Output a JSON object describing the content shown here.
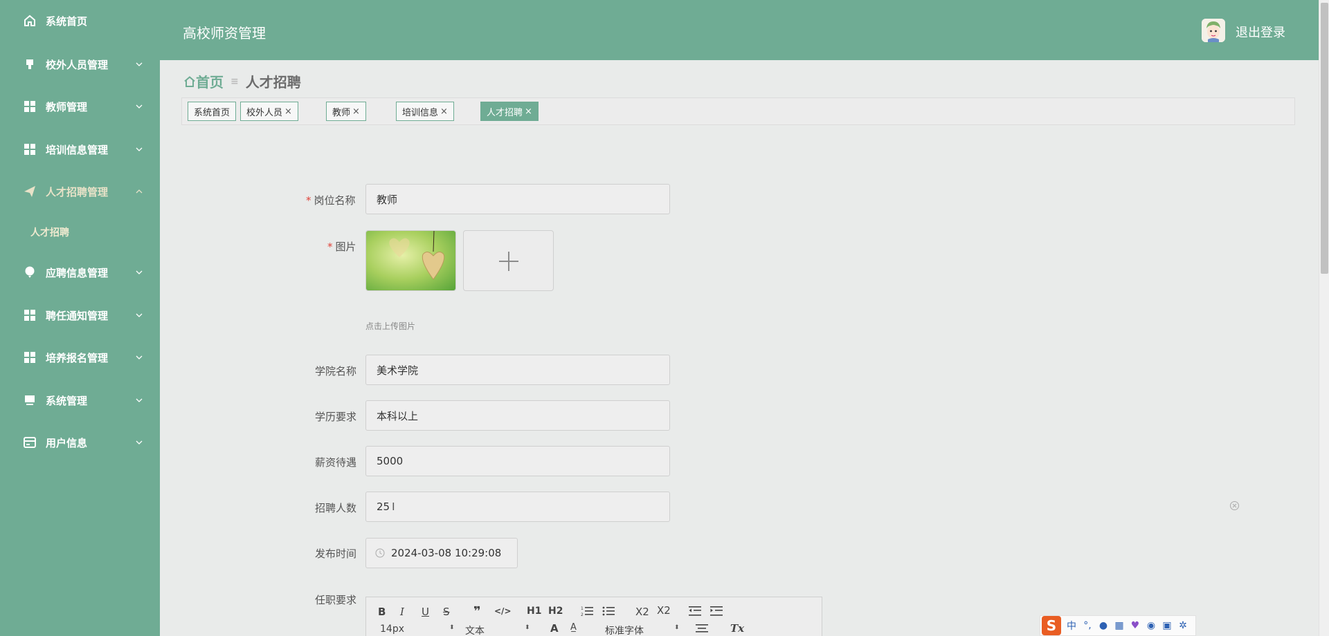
{
  "header": {
    "app_title": "高校师资管理",
    "logout": "退出登录"
  },
  "sidebar": {
    "items": [
      {
        "label": "系统首页",
        "icon": "home-icon"
      },
      {
        "label": "校外人员管理",
        "icon": "brush-icon"
      },
      {
        "label": "教师管理",
        "icon": "grid-icon"
      },
      {
        "label": "培训信息管理",
        "icon": "grid-icon"
      },
      {
        "label": "人才招聘管理",
        "icon": "paper-plane-icon"
      },
      {
        "label": "应聘信息管理",
        "icon": "balloon-icon"
      },
      {
        "label": "聘任通知管理",
        "icon": "grid-icon"
      },
      {
        "label": "培养报名管理",
        "icon": "grid-icon"
      },
      {
        "label": "系统管理",
        "icon": "monitor-icon"
      },
      {
        "label": "用户信息",
        "icon": "card-icon"
      }
    ],
    "sub_item": "人才招聘"
  },
  "breadcrumb": {
    "home": "首页",
    "current": "人才招聘"
  },
  "tags": [
    {
      "label": "系统首页",
      "closable": false
    },
    {
      "label": "校外人员",
      "closable": true
    },
    {
      "label": "教师",
      "closable": true
    },
    {
      "label": "培训信息",
      "closable": true
    },
    {
      "label": "人才招聘",
      "closable": true,
      "active": true
    }
  ],
  "form": {
    "position_label": "岗位名称",
    "position_value": "教师",
    "image_label": "图片",
    "upload_tip": "点击上传图片",
    "college_label": "学院名称",
    "college_value": "美术学院",
    "education_label": "学历要求",
    "education_value": "本科以上",
    "salary_label": "薪资待遇",
    "salary_value": "5000",
    "count_label": "招聘人数",
    "count_value": "25",
    "date_label": "发布时间",
    "date_value": "2024-03-08 10:29:08",
    "requirement_label": "任职要求"
  },
  "editor": {
    "buttons": [
      "B",
      "I",
      "U",
      "S",
      "❞",
      "</>",
      "H1",
      "H2",
      "ordered-list",
      "bullet-list",
      "X2",
      "X2",
      "outdent",
      "indent"
    ],
    "font_size": "14px",
    "text_style": "文本",
    "font_family": "标准字体",
    "clear_format": "Tx"
  },
  "ime": {
    "label": "中"
  },
  "colors": {
    "brand": "#6fac94",
    "background": "#e9ebea",
    "required": "#e0443a"
  }
}
